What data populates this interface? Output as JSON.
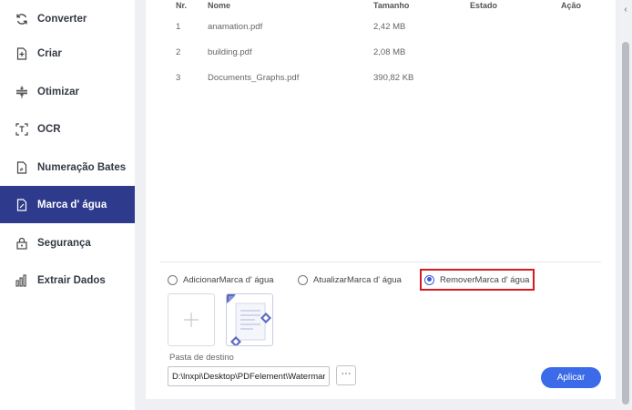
{
  "sidebar": {
    "items": [
      {
        "label": "Converter",
        "icon": "refresh-icon",
        "active": false
      },
      {
        "label": "Criar",
        "icon": "create-file-icon",
        "active": false
      },
      {
        "label": "Otimizar",
        "icon": "compress-icon",
        "active": false
      },
      {
        "label": "OCR",
        "icon": "ocr-scan-icon",
        "active": false
      },
      {
        "label": "Numeração Bates",
        "icon": "bates-number-icon",
        "active": false
      },
      {
        "label": "Marca d' água",
        "icon": "watermark-file-icon",
        "active": true
      },
      {
        "label": "Segurança",
        "icon": "lock-icon",
        "active": false
      },
      {
        "label": "Extrair Dados",
        "icon": "bar-chart-icon",
        "active": false
      }
    ]
  },
  "table": {
    "headers": [
      "Nr.",
      "Nome",
      "Tamanho",
      "Estado",
      "Ação"
    ],
    "rows": [
      {
        "nr": "1",
        "name": "anamation.pdf",
        "size": "2,42 MB"
      },
      {
        "nr": "2",
        "name": "building.pdf",
        "size": "2,08 MB"
      },
      {
        "nr": "3",
        "name": "Documents_Graphs.pdf",
        "size": "390,82 KB"
      }
    ]
  },
  "options": {
    "add": "AdicionarMarca d' água",
    "update": "AtualizarMarca d' água",
    "remove": "RemoverMarca d' água",
    "selected": "remove"
  },
  "destination": {
    "label": "Pasta de destino",
    "path": "D:\\lnxpi\\Desktop\\PDFelement\\Watermark",
    "browse_label": "···"
  },
  "apply_label": "Aplicar",
  "colors": {
    "active_sidebar": "#2e3a8c",
    "accent": "#3b6be8",
    "highlight_border": "#d71920"
  }
}
